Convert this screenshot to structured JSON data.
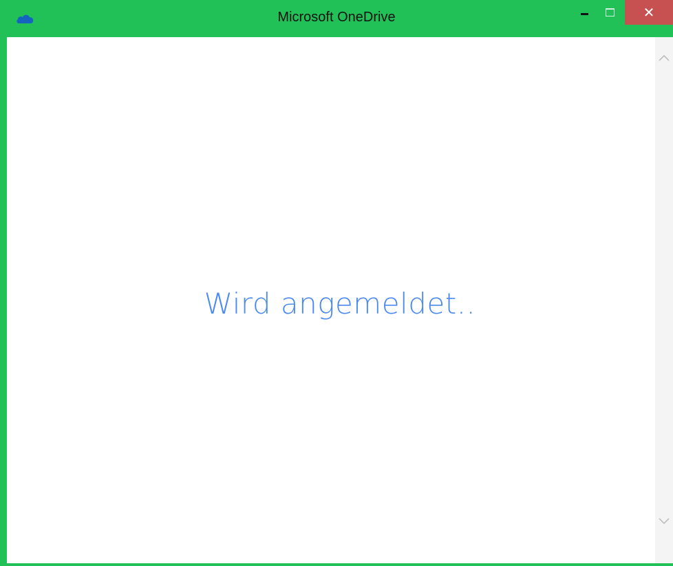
{
  "window": {
    "title": "Microsoft OneDrive",
    "frame_color": "#22c158",
    "close_color": "#c75050"
  },
  "titlebar": {
    "icon": "onedrive-cloud-icon",
    "buttons": {
      "minimize": "minimize-icon",
      "maximize": "maximize-icon",
      "close": "close-icon"
    }
  },
  "content": {
    "status_text": "Wird angemeldet..",
    "status_color": "#4a8af0"
  },
  "scrollbar": {
    "up": "chevron-up-icon",
    "down": "chevron-down-icon"
  }
}
